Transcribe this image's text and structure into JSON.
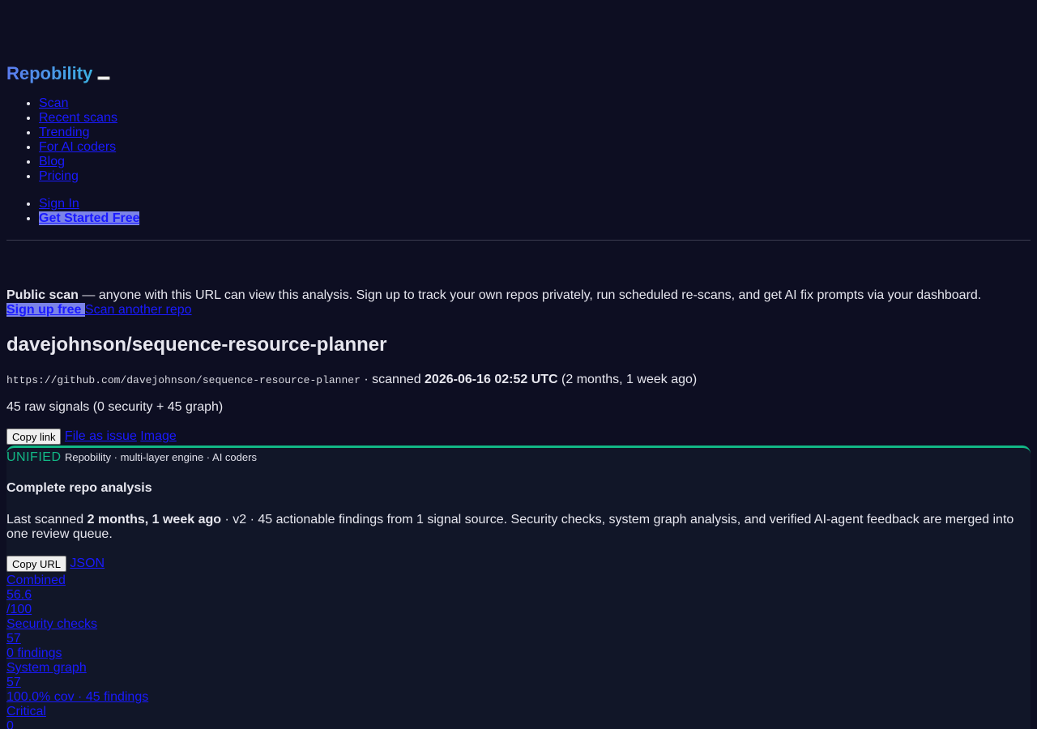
{
  "header": {
    "brand": "Repobility",
    "nav": [
      "Scan",
      "Recent scans",
      "Trending",
      "For AI coders",
      "Blog",
      "Pricing"
    ],
    "sign_in": "Sign In",
    "get_started": "Get Started Free"
  },
  "notice": {
    "strong": "Public scan",
    "text": " — anyone with this URL can view this analysis. Sign up to track your own repos privately, run scheduled re-scans, and get AI fix prompts via your dashboard.",
    "signup": "Sign up free",
    "scan_another": "Scan another repo"
  },
  "repo": {
    "title": "davejohnson/sequence-resource-planner",
    "url": "https://github.com/davejohnson/sequence-resource-planner",
    "scanned_label": " · scanned ",
    "scanned_at": "2026-06-16 02:52 UTC",
    "scanned_ago": " (2 months, 1 week ago)",
    "raw_signals": "45 raw signals (0 security + 45 graph)"
  },
  "actions": {
    "copy_link": "Copy link",
    "file_issue": "File as issue",
    "image": "Image"
  },
  "panel": {
    "badge": "UNIFIED",
    "tagline": "Repobility · multi-layer engine · AI coders",
    "title": "Complete repo analysis",
    "desc_prefix": "Last scanned ",
    "desc_strong": "2 months, 1 week ago",
    "desc_rest": " · v2 · 45 actionable findings from 1 signal source. Security checks, system graph analysis, and verified AI-agent feedback are merged into one review queue.",
    "copy_url": "Copy URL",
    "json": "JSON",
    "accent": "#12b886"
  },
  "metrics": {
    "combined_label": "Combined",
    "combined_value": "56.6",
    "combined_max": "/100",
    "security_label": "Security checks",
    "security_value": "57",
    "security_findings": "0 findings",
    "graph_label": "System graph",
    "graph_value": "57",
    "graph_detail": "100.0% cov · 45 findings",
    "critical_label": "Critical",
    "critical_value": "0"
  }
}
